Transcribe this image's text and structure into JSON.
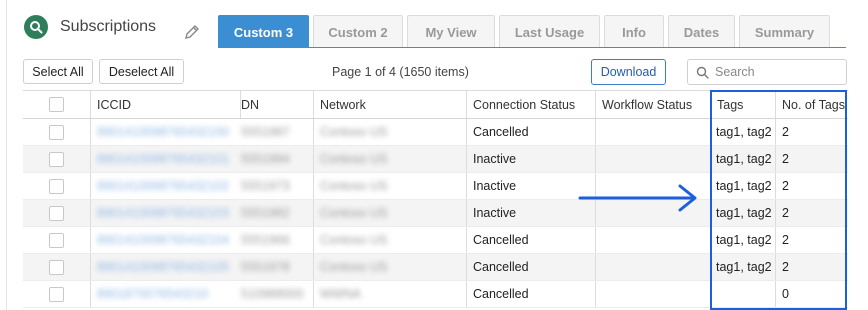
{
  "header": {
    "title": "Subscriptions",
    "logo_icon": "search-icon",
    "edit_icon": "pencil-icon"
  },
  "tabs": [
    {
      "label": "Custom 3",
      "active": true
    },
    {
      "label": "Custom 2",
      "active": false
    },
    {
      "label": "My View",
      "active": false
    },
    {
      "label": "Last Usage",
      "active": false
    },
    {
      "label": "Info",
      "active": false
    },
    {
      "label": "Dates",
      "active": false
    },
    {
      "label": "Summary",
      "active": false
    }
  ],
  "toolbar": {
    "select_all": "Select All",
    "deselect_all": "Deselect All",
    "page_info": "Page 1 of 4 (1650 items)",
    "download": "Download",
    "search_placeholder": "Search"
  },
  "table": {
    "columns": [
      "",
      "ICCID",
      "DN",
      "Network",
      "Connection Status",
      "Workflow Status",
      "Tags",
      "No. of Tags"
    ],
    "rows": [
      {
        "iccid": "8901410098765432100",
        "dn": "5551987",
        "network": "Contoso US",
        "connection_status": "Cancelled",
        "workflow_status": "",
        "tags": "tag1, tag2",
        "no_of_tags": "2"
      },
      {
        "iccid": "8901410098765432101",
        "dn": "5551994",
        "network": "Contoso US",
        "connection_status": "Inactive",
        "workflow_status": "",
        "tags": "tag1, tag2",
        "no_of_tags": "2"
      },
      {
        "iccid": "8901410098765432102",
        "dn": "5551973",
        "network": "Contoso US",
        "connection_status": "Inactive",
        "workflow_status": "",
        "tags": "tag1, tag2",
        "no_of_tags": "2"
      },
      {
        "iccid": "8901410098765432103",
        "dn": "5551982",
        "network": "Contoso US",
        "connection_status": "Inactive",
        "workflow_status": "",
        "tags": "tag1, tag2",
        "no_of_tags": "2"
      },
      {
        "iccid": "8901410098765432104",
        "dn": "5551966",
        "network": "Contoso US",
        "connection_status": "Cancelled",
        "workflow_status": "",
        "tags": "tag1, tag2",
        "no_of_tags": "2"
      },
      {
        "iccid": "8901410098765432105",
        "dn": "5551978",
        "network": "Contoso US",
        "connection_status": "Cancelled",
        "workflow_status": "",
        "tags": "tag1, tag2",
        "no_of_tags": "2"
      },
      {
        "iccid": "8901870076543210",
        "dn": "510988000",
        "network": "WWNA",
        "connection_status": "Cancelled",
        "workflow_status": "",
        "tags": "",
        "no_of_tags": "0"
      }
    ]
  },
  "colors": {
    "accent": "#3c8ed3",
    "highlight": "#1b5fdc",
    "logo": "#2e7d5b"
  }
}
